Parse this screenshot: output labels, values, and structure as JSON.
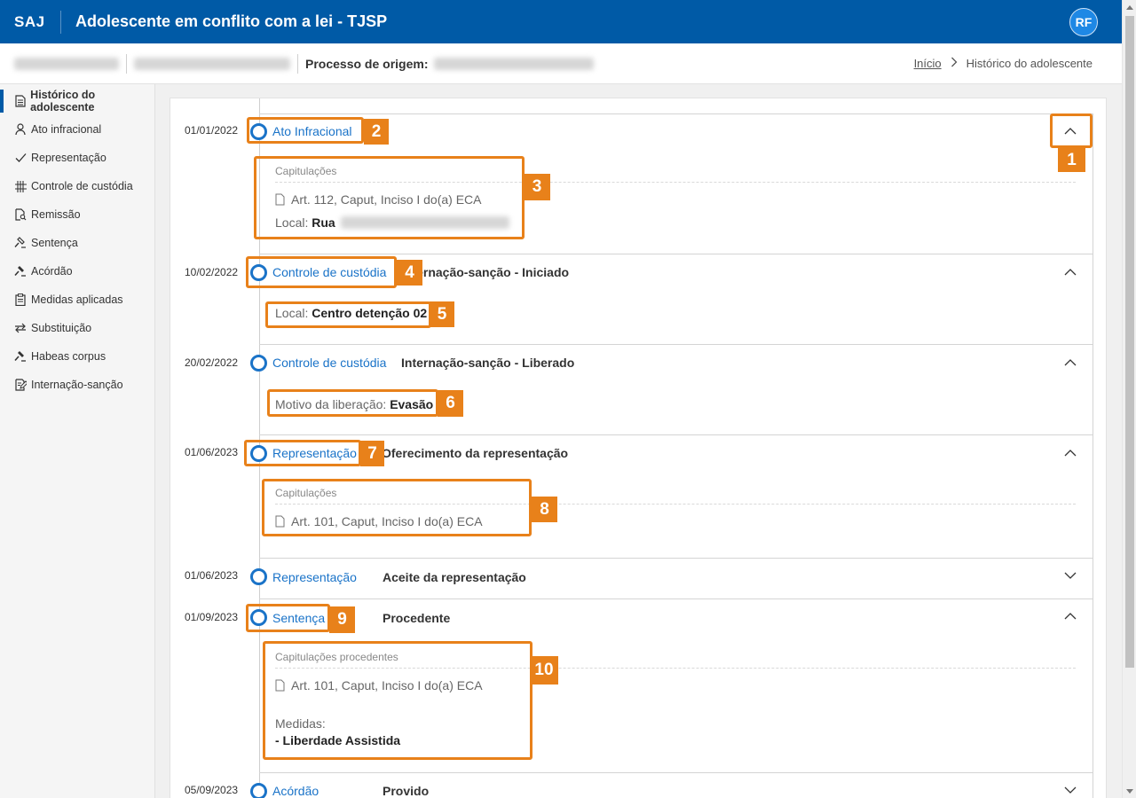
{
  "header": {
    "brand": "SAJ",
    "title": "Adolescente em conflito com a lei - TJSP",
    "avatar_initials": "RF",
    "color": "#005aa6"
  },
  "subheader": {
    "process_label": "Processo de origem:",
    "breadcrumb": {
      "home": "Início",
      "current": "Histórico do adolescente"
    }
  },
  "sidebar": {
    "items": [
      {
        "label": "Histórico do adolescente",
        "icon": "document-icon",
        "active": true
      },
      {
        "label": "Ato infracional",
        "icon": "person-icon"
      },
      {
        "label": "Representação",
        "icon": "check-icon"
      },
      {
        "label": "Controle de custódia",
        "icon": "bars-icon"
      },
      {
        "label": "Remissão",
        "icon": "document-search-icon"
      },
      {
        "label": "Sentença",
        "icon": "gavel-icon"
      },
      {
        "label": "Acórdão",
        "icon": "gavel-filled-icon"
      },
      {
        "label": "Medidas aplicadas",
        "icon": "clipboard-icon"
      },
      {
        "label": "Substituição",
        "icon": "swap-icon"
      },
      {
        "label": "Habeas corpus",
        "icon": "gavel-filled-icon"
      },
      {
        "label": "Internação-sanção",
        "icon": "edit-document-icon"
      }
    ]
  },
  "timeline": {
    "events": [
      {
        "date": "01/01/2022",
        "type": "Ato Infracional",
        "desc": "",
        "expanded": true,
        "details": {
          "cap_label": "Capitulações",
          "article": "Art. 112, Caput, Inciso I do(a) ECA",
          "local_label": "Local:",
          "local_value": "Rua"
        }
      },
      {
        "date": "10/02/2022",
        "type": "Controle de custódia",
        "desc": "Internação-sanção - Iniciado",
        "expanded": true,
        "details": {
          "local_label": "Local:",
          "local_value": "Centro detenção 02"
        }
      },
      {
        "date": "20/02/2022",
        "type": "Controle de custódia",
        "desc": "Internação-sanção - Liberado",
        "expanded": true,
        "details": {
          "motivo_label": "Motivo da liberação:",
          "motivo_value": "Evasão"
        }
      },
      {
        "date": "01/06/2023",
        "type": "Representação",
        "desc": "Oferecimento da representação",
        "expanded": true,
        "details": {
          "cap_label": "Capitulações",
          "article": "Art. 101, Caput, Inciso I do(a) ECA"
        }
      },
      {
        "date": "01/06/2023",
        "type": "Representação",
        "desc": "Aceite da representação",
        "expanded": false
      },
      {
        "date": "01/09/2023",
        "type": "Sentença",
        "desc": "Procedente",
        "expanded": true,
        "details": {
          "cap_label": "Capitulações procedentes",
          "article": "Art. 101, Caput, Inciso I do(a) ECA",
          "medidas_label": "Medidas:",
          "medidas_value": "- Liberdade Assistida"
        }
      },
      {
        "date": "05/09/2023",
        "type": "Acórdão",
        "desc": "Provido",
        "expanded": false
      }
    ]
  },
  "callouts": {
    "1": "1",
    "2": "2",
    "3": "3",
    "4": "4",
    "5": "5",
    "6": "6",
    "7": "7",
    "8": "8",
    "9": "9",
    "10": "10",
    "color": "#e8811a"
  }
}
